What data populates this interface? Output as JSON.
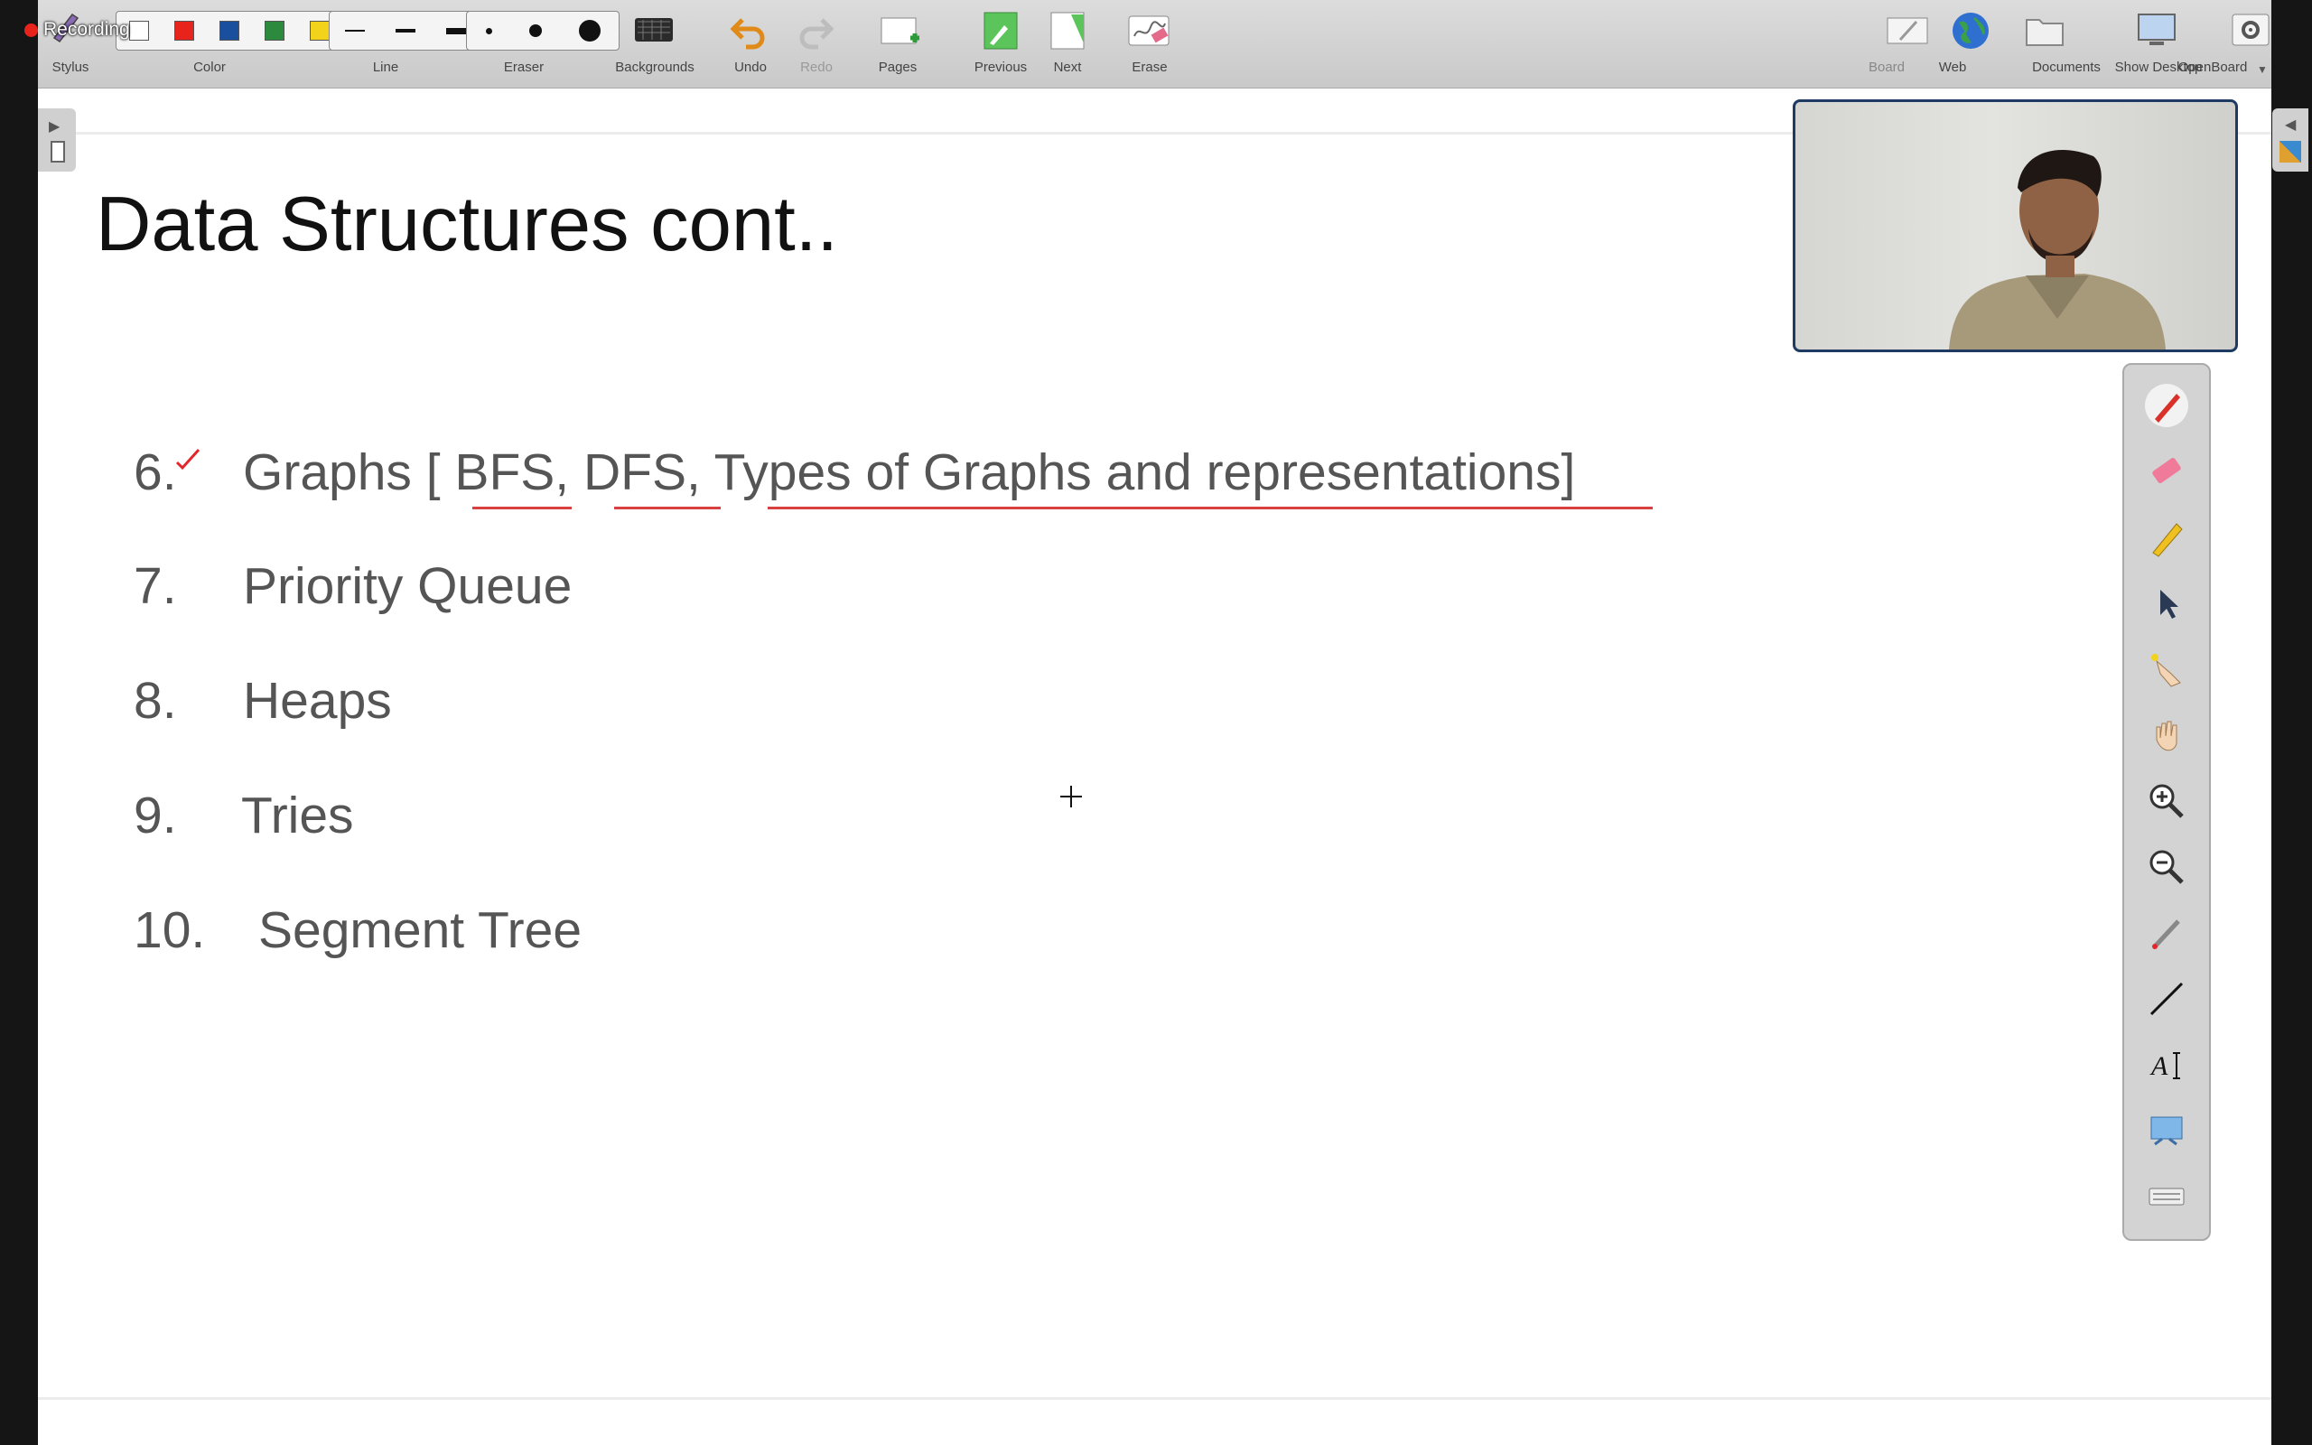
{
  "recording": {
    "label": "Recording"
  },
  "toolbar": {
    "stylus": "Stylus",
    "color": "Color",
    "line": "Line",
    "eraser": "Eraser",
    "backgrounds": "Backgrounds",
    "undo": "Undo",
    "redo": "Redo",
    "pages": "Pages",
    "previous": "Previous",
    "next": "Next",
    "erase": "Erase",
    "board": "Board",
    "web": "Web",
    "documents": "Documents",
    "show_desktop": "Show Desktop",
    "openboard": "OpenBoard",
    "colors": [
      "#e8231c",
      "#1a4f9e",
      "#2b8a3e",
      "#f2d21b"
    ]
  },
  "slide": {
    "title": "Data Structures cont..",
    "items": [
      {
        "num": "6.",
        "text": "Graphs [ BFS, DFS, Types of Graphs and representations]"
      },
      {
        "num": "7.",
        "text": "Priority Queue"
      },
      {
        "num": "8.",
        "text": "Heaps"
      },
      {
        "num": "9.",
        "text": "Tries"
      },
      {
        "num": "10.",
        "text": "Segment Tree"
      }
    ]
  },
  "palette": {
    "tools": [
      "pen-icon",
      "eraser-icon",
      "highlighter-icon",
      "pointer-icon",
      "play-hand-icon",
      "hand-icon",
      "zoom-in-icon",
      "zoom-out-icon",
      "laser-icon",
      "line-icon",
      "text-icon",
      "capture-icon",
      "keyboard-icon"
    ]
  }
}
